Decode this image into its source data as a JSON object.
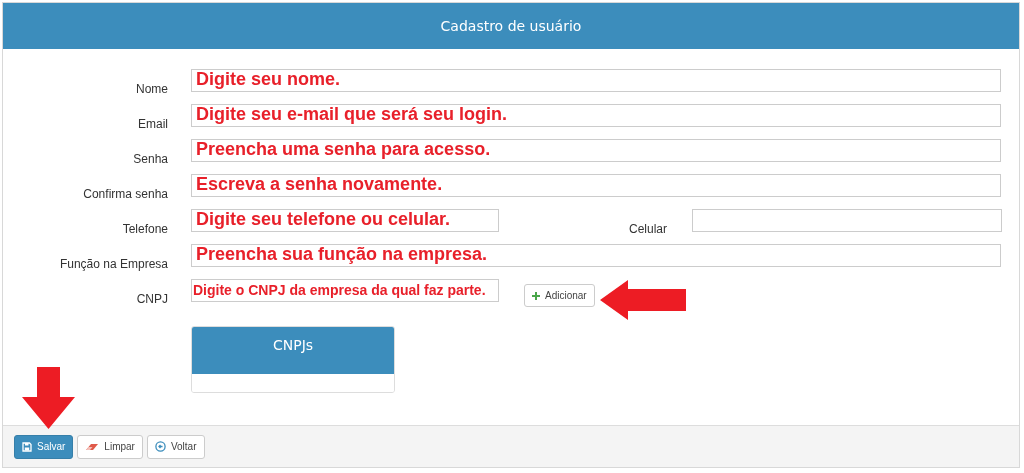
{
  "header": {
    "title": "Cadastro de usuário"
  },
  "rows": [
    {
      "kind": "full",
      "label": "Nome",
      "annotation": "Digite seu nome."
    },
    {
      "kind": "full",
      "label": "Email",
      "annotation": "Digite seu e-mail que será seu login."
    },
    {
      "kind": "full",
      "label": "Senha",
      "annotation": "Preencha uma senha para acesso."
    },
    {
      "kind": "full",
      "label": "Confirma senha",
      "annotation": "Escreva a senha novamente."
    },
    {
      "kind": "pair",
      "label": "Telefone",
      "annotation": "Digite seu telefone ou celular.",
      "second_label": "Celular"
    },
    {
      "kind": "full",
      "label": "Função na Empresa",
      "annotation": "Preencha sua função na empresa."
    },
    {
      "kind": "button",
      "label": "CNPJ",
      "annotation": "Digite o CNPJ da empresa da qual faz parte.",
      "button": "Adicionar"
    }
  ],
  "table": {
    "heading": "CNPJs"
  },
  "footer_buttons": [
    {
      "kind": "primary",
      "label": "Salvar"
    },
    {
      "kind": "default",
      "label": "Limpar"
    },
    {
      "kind": "default",
      "label": "Voltar"
    }
  ]
}
